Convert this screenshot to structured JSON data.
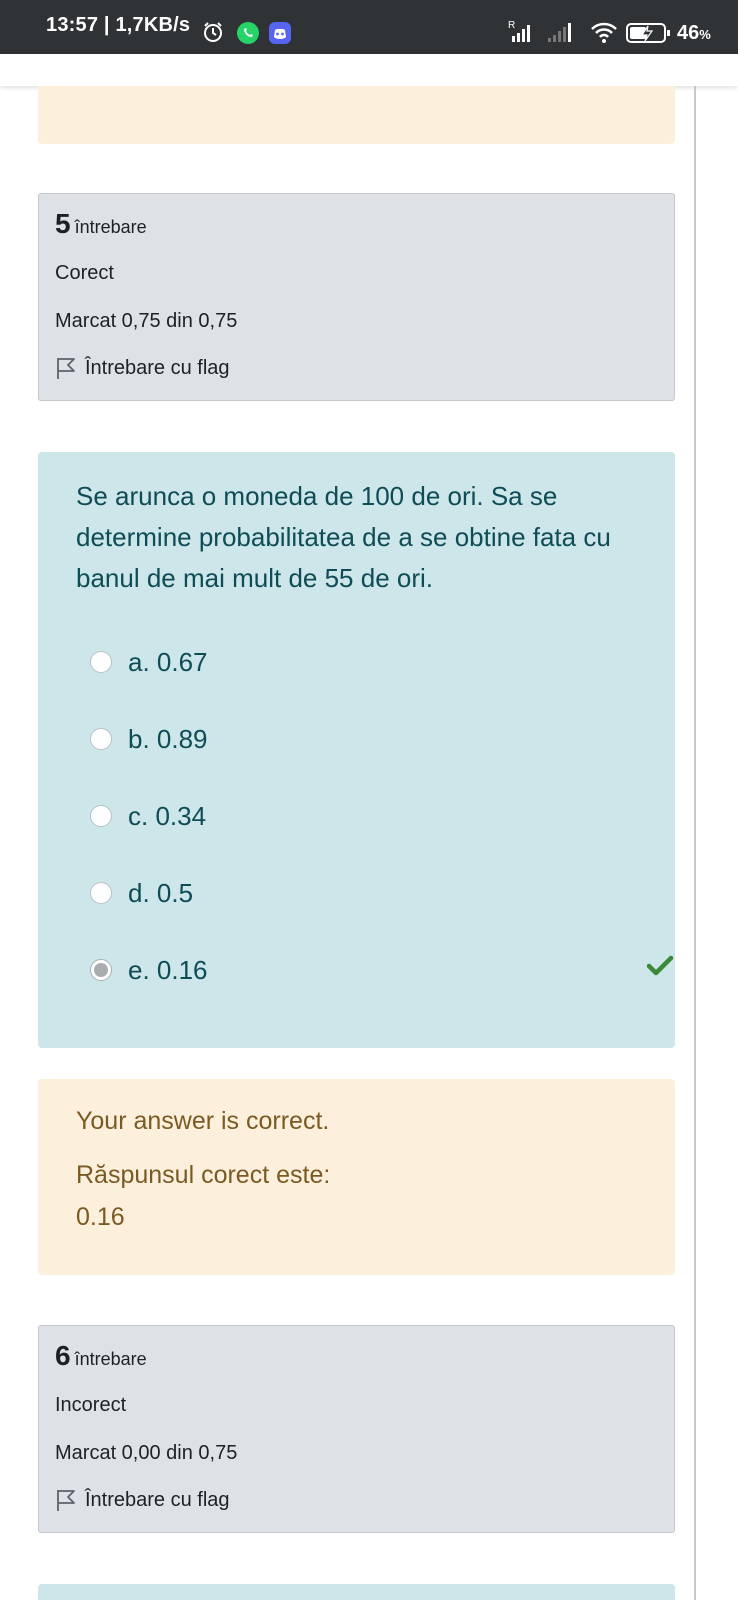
{
  "status_bar": {
    "time": "13:57 | 1,7KB/s",
    "battery": "46",
    "battery_unit": "%",
    "icons": [
      "alarm-icon",
      "whatsapp-icon",
      "discord-icon",
      "roaming-signal-icon",
      "signal-icon",
      "wifi-icon",
      "battery-charging-icon"
    ]
  },
  "question5_info": {
    "number": "5",
    "label": "întrebare",
    "state": "Corect",
    "grade": "Marcat 0,75 din 0,75",
    "flag_label": "Întrebare cu flag"
  },
  "question5": {
    "text": "Se arunca o moneda de 100 de ori. Sa se determine probabilitatea de a se obtine fata cu banul de mai mult de 55 de ori.",
    "options": [
      {
        "label": "a. 0.67",
        "selected": false
      },
      {
        "label": "b. 0.89",
        "selected": false
      },
      {
        "label": "c. 0.34",
        "selected": false
      },
      {
        "label": "d. 0.5",
        "selected": false
      },
      {
        "label": "e. 0.16",
        "selected": true,
        "correct": true
      }
    ]
  },
  "feedback": {
    "result": "Your answer is correct.",
    "correct_label": "Răspunsul corect este:",
    "correct_value": "0.16"
  },
  "question6_info": {
    "number": "6",
    "label": "întrebare",
    "state": "Incorect",
    "grade": "Marcat 0,00 din 0,75",
    "flag_label": "Întrebare cu flag"
  },
  "colors": {
    "status_bar": "#303336",
    "info_box": "#dee2e6",
    "question_box": "#cce6ea",
    "feedback_box": "#fcefdc",
    "question_text": "#0f4c55",
    "feedback_text": "#7a5a22",
    "correct_check": "#3a8a3a"
  }
}
